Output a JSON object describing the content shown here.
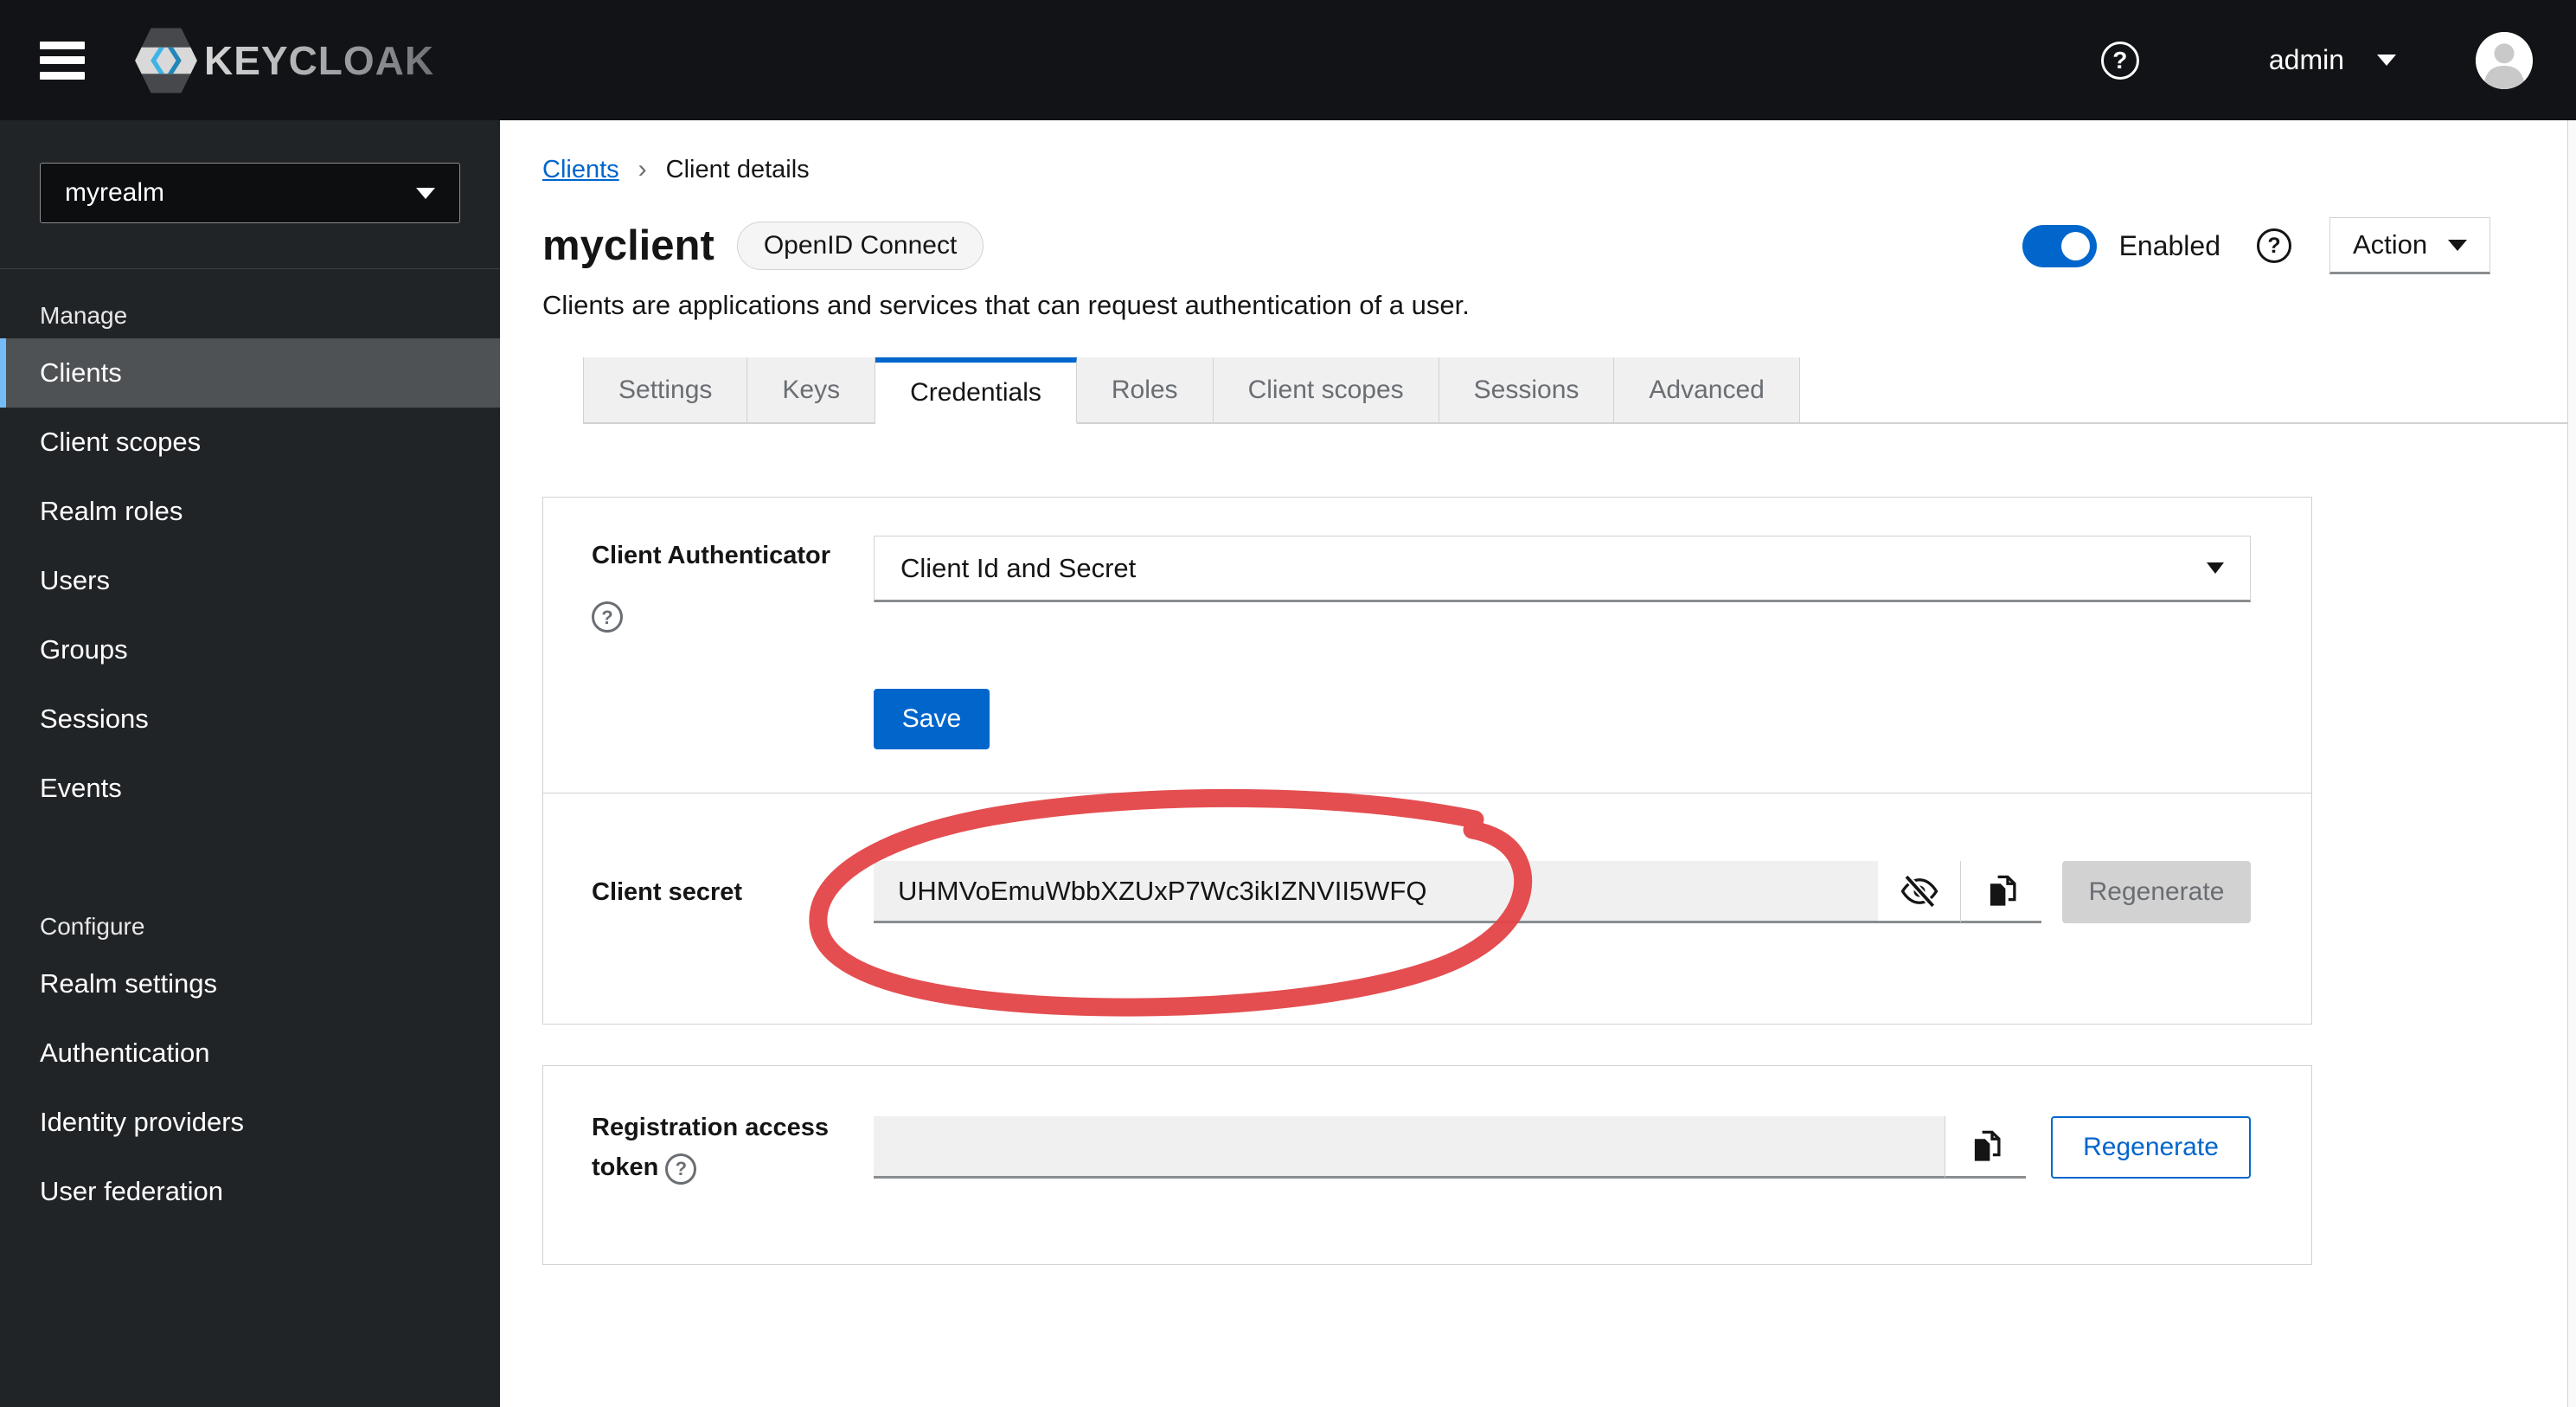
{
  "header": {
    "brand": "KEYCLOAK",
    "help_icon_glyph": "?",
    "username": "admin"
  },
  "sidebar": {
    "realm_select": {
      "value": "myrealm"
    },
    "sections": [
      {
        "title": "Manage",
        "items": [
          {
            "label": "Clients",
            "selected": true
          },
          {
            "label": "Client scopes"
          },
          {
            "label": "Realm roles"
          },
          {
            "label": "Users"
          },
          {
            "label": "Groups"
          },
          {
            "label": "Sessions"
          },
          {
            "label": "Events"
          }
        ]
      },
      {
        "title": "Configure",
        "items": [
          {
            "label": "Realm settings"
          },
          {
            "label": "Authentication"
          },
          {
            "label": "Identity providers"
          },
          {
            "label": "User federation"
          }
        ]
      }
    ]
  },
  "breadcrumb": {
    "link": "Clients",
    "separator": "›",
    "current": "Client details"
  },
  "page_header": {
    "title": "myclient",
    "badge": "OpenID Connect",
    "description": "Clients are applications and services that can request authentication of a user.",
    "enabled_toggle": {
      "label": "Enabled",
      "state": "on"
    },
    "help_glyph": "?",
    "action_button": {
      "label": "Action"
    }
  },
  "tabs": {
    "active": "Credentials",
    "items": [
      {
        "label": "Settings"
      },
      {
        "label": "Keys"
      },
      {
        "label": "Credentials"
      },
      {
        "label": "Roles"
      },
      {
        "label": "Client scopes"
      },
      {
        "label": "Sessions"
      },
      {
        "label": "Advanced"
      }
    ]
  },
  "credentials_form": {
    "client_authenticator": {
      "label": "Client Authenticator",
      "selected_option": "Client Id and Secret"
    },
    "save_button": "Save",
    "client_secret": {
      "label": "Client secret",
      "value": "UHMVoEmuWbbXZUxP7Wc3ikIZNVII5WFQ",
      "regenerate_button": "Regenerate",
      "regenerate_disabled": true
    },
    "registration_access_token": {
      "label": "Registration access token",
      "value": "",
      "regenerate_button": "Regenerate"
    }
  },
  "annotation": {
    "shape": "hand-drawn-circle",
    "target": "client-secret-value",
    "color": "#e34547"
  },
  "colors": {
    "primary_blue": "#0066cc",
    "header_bg": "#121316",
    "sidebar_bg": "#212427",
    "sidebar_selected_bg": "#4f5255",
    "sidebar_selected_accent": "#73bcf7",
    "tab_inactive_bg": "#f0f0f0",
    "border": "#d2d2d2",
    "input_bg": "#f0f0f0",
    "input_border_bottom": "#8a8d90",
    "disabled_bg": "#d2d2d2",
    "muted_text": "#6a6e73",
    "annotation_red": "#e34547"
  }
}
